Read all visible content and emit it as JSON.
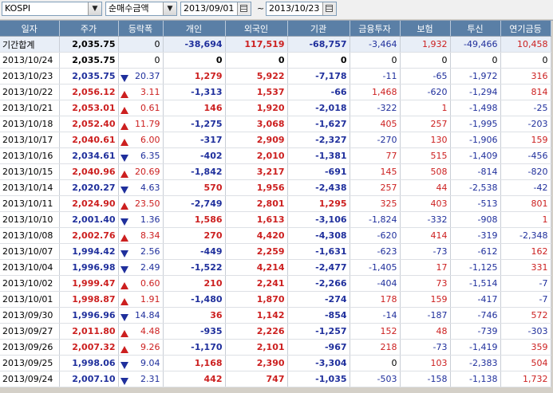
{
  "toolbar": {
    "market": "KOSPI",
    "metric": "순매수금액",
    "start_date": "2013/09/01",
    "separator": "~",
    "end_date": "2013/10/23"
  },
  "columns": [
    "일자",
    "주가",
    "등락폭",
    "개인",
    "외국인",
    "기관",
    "금융투자",
    "보험",
    "투신",
    "연기금등"
  ],
  "colors": {
    "header": "#5a7fa6",
    "up": "#cc1f1f",
    "down": "#1f2f9c"
  },
  "rows": [
    {
      "date": "기간합계",
      "price": "2,035.75",
      "dir": "",
      "chg": "0",
      "ind": "-38,694",
      "for": "117,519",
      "inst": "-68,757",
      "fin": "-3,464",
      "ins": "1,932",
      "trust": "-49,466",
      "pen": "10,458",
      "sum": true
    },
    {
      "date": "2013/10/24",
      "price": "2,035.75",
      "dir": "",
      "chg": "0",
      "ind": "0",
      "for": "0",
      "inst": "0",
      "fin": "0",
      "ins": "0",
      "trust": "0",
      "pen": "0"
    },
    {
      "date": "2013/10/23",
      "price": "2,035.75",
      "dir": "down",
      "chg": "20.37",
      "ind": "1,279",
      "for": "5,922",
      "inst": "-7,178",
      "fin": "-11",
      "ins": "-65",
      "trust": "-1,972",
      "pen": "316"
    },
    {
      "date": "2013/10/22",
      "price": "2,056.12",
      "dir": "up",
      "chg": "3.11",
      "ind": "-1,313",
      "for": "1,537",
      "inst": "-66",
      "fin": "1,468",
      "ins": "-620",
      "trust": "-1,294",
      "pen": "814"
    },
    {
      "date": "2013/10/21",
      "price": "2,053.01",
      "dir": "up",
      "chg": "0.61",
      "ind": "146",
      "for": "1,920",
      "inst": "-2,018",
      "fin": "-322",
      "ins": "1",
      "trust": "-1,498",
      "pen": "-25"
    },
    {
      "date": "2013/10/18",
      "price": "2,052.40",
      "dir": "up",
      "chg": "11.79",
      "ind": "-1,275",
      "for": "3,068",
      "inst": "-1,627",
      "fin": "405",
      "ins": "257",
      "trust": "-1,995",
      "pen": "-203"
    },
    {
      "date": "2013/10/17",
      "price": "2,040.61",
      "dir": "up",
      "chg": "6.00",
      "ind": "-317",
      "for": "2,909",
      "inst": "-2,327",
      "fin": "-270",
      "ins": "130",
      "trust": "-1,906",
      "pen": "159"
    },
    {
      "date": "2013/10/16",
      "price": "2,034.61",
      "dir": "down",
      "chg": "6.35",
      "ind": "-402",
      "for": "2,010",
      "inst": "-1,381",
      "fin": "77",
      "ins": "515",
      "trust": "-1,409",
      "pen": "-456"
    },
    {
      "date": "2013/10/15",
      "price": "2,040.96",
      "dir": "up",
      "chg": "20.69",
      "ind": "-1,842",
      "for": "3,217",
      "inst": "-691",
      "fin": "145",
      "ins": "508",
      "trust": "-814",
      "pen": "-820"
    },
    {
      "date": "2013/10/14",
      "price": "2,020.27",
      "dir": "down",
      "chg": "4.63",
      "ind": "570",
      "for": "1,956",
      "inst": "-2,438",
      "fin": "257",
      "ins": "44",
      "trust": "-2,538",
      "pen": "-42"
    },
    {
      "date": "2013/10/11",
      "price": "2,024.90",
      "dir": "up",
      "chg": "23.50",
      "ind": "-2,749",
      "for": "2,801",
      "inst": "1,295",
      "fin": "325",
      "ins": "403",
      "trust": "-513",
      "pen": "801"
    },
    {
      "date": "2013/10/10",
      "price": "2,001.40",
      "dir": "down",
      "chg": "1.36",
      "ind": "1,586",
      "for": "1,613",
      "inst": "-3,106",
      "fin": "-1,824",
      "ins": "-332",
      "trust": "-908",
      "pen": "1"
    },
    {
      "date": "2013/10/08",
      "price": "2,002.76",
      "dir": "up",
      "chg": "8.34",
      "ind": "270",
      "for": "4,420",
      "inst": "-4,308",
      "fin": "-620",
      "ins": "414",
      "trust": "-319",
      "pen": "-2,348"
    },
    {
      "date": "2013/10/07",
      "price": "1,994.42",
      "dir": "down",
      "chg": "2.56",
      "ind": "-449",
      "for": "2,259",
      "inst": "-1,631",
      "fin": "-623",
      "ins": "-73",
      "trust": "-612",
      "pen": "162"
    },
    {
      "date": "2013/10/04",
      "price": "1,996.98",
      "dir": "down",
      "chg": "2.49",
      "ind": "-1,522",
      "for": "4,214",
      "inst": "-2,477",
      "fin": "-1,405",
      "ins": "17",
      "trust": "-1,125",
      "pen": "331"
    },
    {
      "date": "2013/10/02",
      "price": "1,999.47",
      "dir": "up",
      "chg": "0.60",
      "ind": "210",
      "for": "2,241",
      "inst": "-2,266",
      "fin": "-404",
      "ins": "73",
      "trust": "-1,514",
      "pen": "-7"
    },
    {
      "date": "2013/10/01",
      "price": "1,998.87",
      "dir": "up",
      "chg": "1.91",
      "ind": "-1,480",
      "for": "1,870",
      "inst": "-274",
      "fin": "178",
      "ins": "159",
      "trust": "-417",
      "pen": "-7"
    },
    {
      "date": "2013/09/30",
      "price": "1,996.96",
      "dir": "down",
      "chg": "14.84",
      "ind": "36",
      "for": "1,142",
      "inst": "-854",
      "fin": "-14",
      "ins": "-187",
      "trust": "-746",
      "pen": "572"
    },
    {
      "date": "2013/09/27",
      "price": "2,011.80",
      "dir": "up",
      "chg": "4.48",
      "ind": "-935",
      "for": "2,226",
      "inst": "-1,257",
      "fin": "152",
      "ins": "48",
      "trust": "-739",
      "pen": "-303"
    },
    {
      "date": "2013/09/26",
      "price": "2,007.32",
      "dir": "up",
      "chg": "9.26",
      "ind": "-1,170",
      "for": "2,101",
      "inst": "-967",
      "fin": "218",
      "ins": "-73",
      "trust": "-1,419",
      "pen": "359"
    },
    {
      "date": "2013/09/25",
      "price": "1,998.06",
      "dir": "down",
      "chg": "9.04",
      "ind": "1,168",
      "for": "2,390",
      "inst": "-3,304",
      "fin": "0",
      "ins": "103",
      "trust": "-2,383",
      "pen": "504"
    },
    {
      "date": "2013/09/24",
      "price": "2,007.10",
      "dir": "down",
      "chg": "2.31",
      "ind": "442",
      "for": "747",
      "inst": "-1,035",
      "fin": "-503",
      "ins": "-158",
      "trust": "-1,138",
      "pen": "1,732"
    }
  ]
}
